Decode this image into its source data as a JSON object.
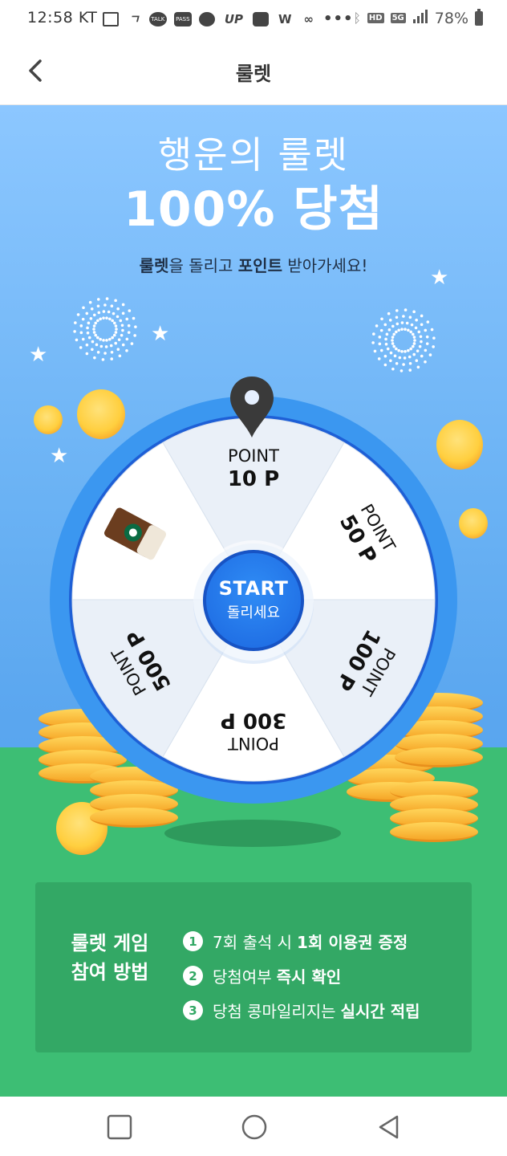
{
  "status_bar": {
    "time": "12:58",
    "carrier": "KT",
    "icon_labels": [
      "TALK",
      "PASS",
      "UP",
      "W"
    ],
    "network": "5G",
    "hd_label": "HD",
    "battery": "78%"
  },
  "app_bar": {
    "title": "룰렛"
  },
  "headline": {
    "line1": "행운의 룰렛",
    "line2": "100% 당첨",
    "sub_bold1": "룰렛",
    "sub_text1": "을 돌리고 ",
    "sub_bold2": "포인트",
    "sub_text2": " 받아가세요!"
  },
  "wheel": {
    "segments": [
      {
        "label": "POINT",
        "value": "10 P"
      },
      {
        "label": "POINT",
        "value": "50 P"
      },
      {
        "label": "POINT",
        "value": "100 P"
      },
      {
        "label": "POINT",
        "value": "300 P"
      },
      {
        "label": "POINT",
        "value": "500 P"
      },
      {
        "label": "",
        "value": "",
        "icon": "coffee-cup-icon"
      }
    ],
    "colors": {
      "ring": "#3b97f0",
      "ring_inner": "#1e5fd6",
      "seg_light": "#ffffff",
      "seg_gray": "#eaf0f8",
      "pin": "#3a3a3a"
    }
  },
  "start_button": {
    "label": "START",
    "sub": "돌리세요"
  },
  "info": {
    "title_line1": "룰렛 게임",
    "title_line2": "참여 방법",
    "items": [
      {
        "num": "1",
        "text": "7회 출석 시",
        "bold": "1회 이용권 증정"
      },
      {
        "num": "2",
        "text": "당첨여부",
        "bold": "즉시 확인"
      },
      {
        "num": "3",
        "text": "당첨 콩마일리지는",
        "bold": "실시간 적립"
      }
    ]
  },
  "nav_bar": {
    "items": [
      "recents-icon",
      "home-icon",
      "back-icon"
    ]
  }
}
